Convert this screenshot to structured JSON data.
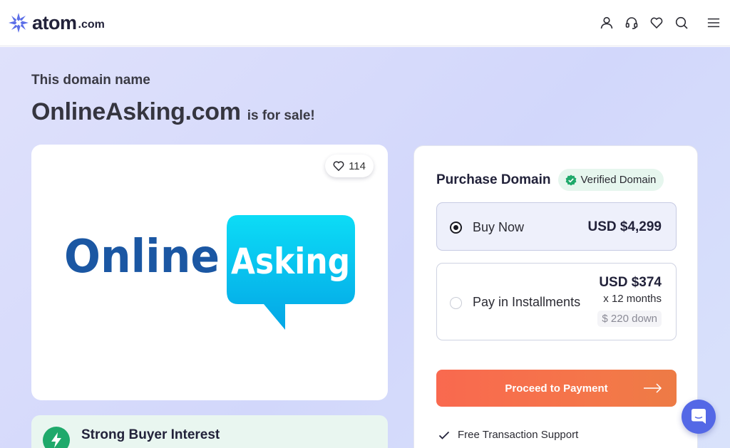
{
  "header": {
    "logo_word": "atom",
    "logo_tld": ".com",
    "icons": [
      "user-icon",
      "headset-icon",
      "heart-icon",
      "search-icon",
      "menu-icon"
    ]
  },
  "hero": {
    "kicker": "This domain name",
    "domain_name": "OnlineAsking.com",
    "for_sale_text": "is for sale!"
  },
  "logo_card": {
    "favorites_count": "114",
    "logo_word_1": "Online",
    "logo_word_2": "Asking"
  },
  "interest": {
    "title": "Strong Buyer Interest"
  },
  "purchase": {
    "title": "Purchase Domain",
    "verified_label": "Verified Domain",
    "options": [
      {
        "label": "Buy Now",
        "price": "USD $4,299",
        "selected": true
      },
      {
        "label": "Pay in Installments",
        "price": "USD $374",
        "term": "x 12 months",
        "down": "$ 220 down",
        "selected": false
      }
    ],
    "cta_label": "Proceed to Payment",
    "features": [
      "Free Transaction Support"
    ]
  },
  "colors": {
    "accent": "#f9694f",
    "brand": "#5468e6",
    "verified_green": "#1fa96b",
    "logo_blue": "#1b57a3",
    "logo_cyan": "#08c3ef"
  }
}
